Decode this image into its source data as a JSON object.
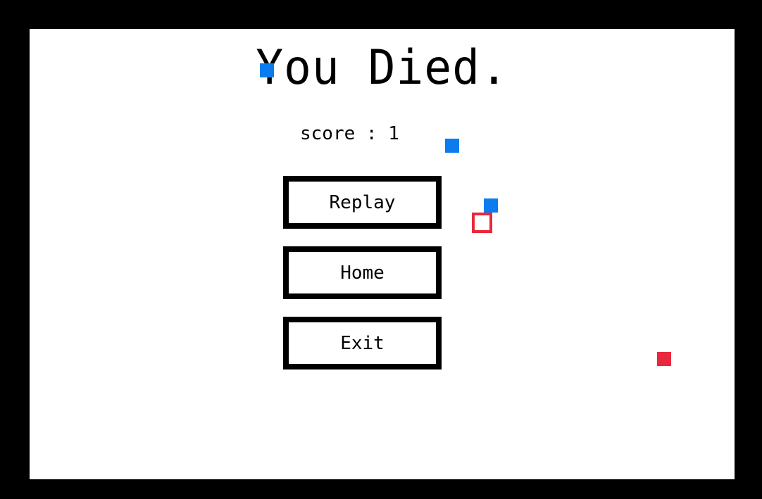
{
  "screen": {
    "title": "You Died.",
    "score_label": "score : 1",
    "score": 1
  },
  "menu": {
    "replay_label": "Replay",
    "home_label": "Home",
    "exit_label": "Exit"
  },
  "colors": {
    "background": "#000000",
    "play_area": "#ffffff",
    "ink": "#000000",
    "blue_square": "#0a7cf0",
    "red_square": "#e8283c"
  },
  "entities": [
    {
      "name": "blue-square-1",
      "color": "blue"
    },
    {
      "name": "blue-square-2",
      "color": "blue"
    },
    {
      "name": "blue-square-3",
      "color": "blue"
    },
    {
      "name": "player-outline-square",
      "color": "red"
    },
    {
      "name": "red-square",
      "color": "red"
    }
  ]
}
